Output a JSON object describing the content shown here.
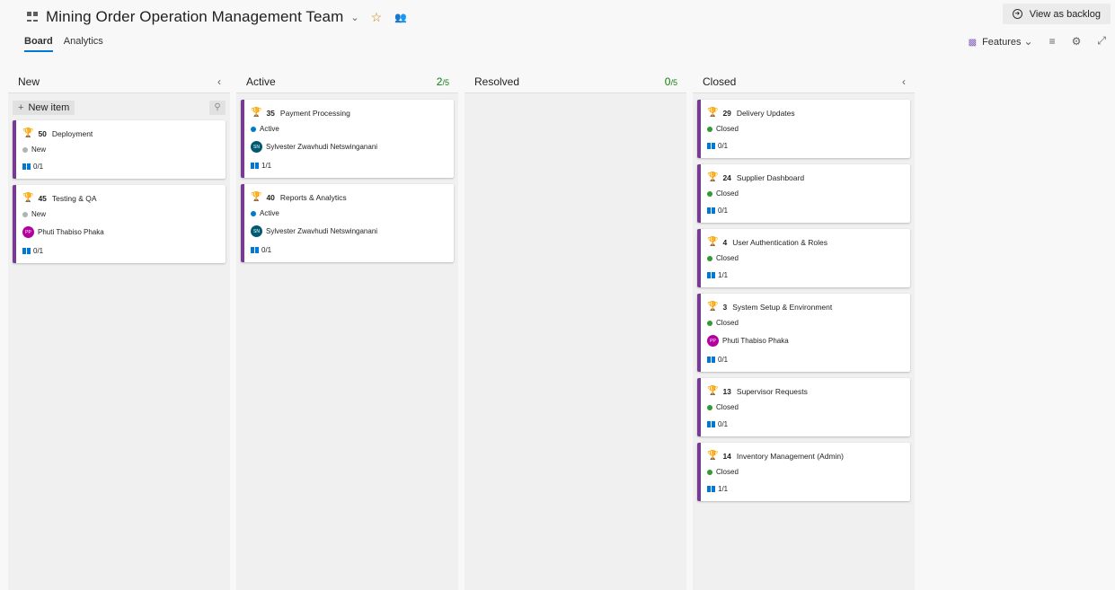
{
  "header": {
    "team_title": "Mining Order Operation Management Team",
    "view_backlog_label": "View as backlog",
    "tabs": [
      {
        "label": "Board",
        "active": true
      },
      {
        "label": "Analytics",
        "active": false
      }
    ],
    "features_label": "Features"
  },
  "colors": {
    "accent": "#0078d4",
    "feature": "#773b93",
    "new": "#b2b2b2",
    "active": "#007acc",
    "closed": "#339933"
  },
  "columns": [
    {
      "title": "New",
      "wip": "",
      "new_item_label": "New item",
      "cards": [
        {
          "id": "50",
          "title": "Deployment",
          "state": "New",
          "assignee": null,
          "initials": null,
          "progress": "0/1"
        },
        {
          "id": "45",
          "title": "Testing & QA",
          "state": "New",
          "assignee": "Phuti Thabiso Phaka",
          "initials": "PP",
          "progress": "0/1"
        }
      ]
    },
    {
      "title": "Active",
      "wip": "2",
      "wip_limit": "/5",
      "cards": [
        {
          "id": "35",
          "title": "Payment Processing",
          "state": "Active",
          "assignee": "Sylvester Zwavhudi Netswinganani",
          "initials": "SN",
          "progress": "1/1"
        },
        {
          "id": "40",
          "title": "Reports & Analytics",
          "state": "Active",
          "assignee": "Sylvester Zwavhudi Netswinganani",
          "initials": "SN",
          "progress": "0/1"
        }
      ]
    },
    {
      "title": "Resolved",
      "wip": "0",
      "wip_limit": "/5",
      "cards": []
    },
    {
      "title": "Closed",
      "wip": "",
      "cards": [
        {
          "id": "29",
          "title": "Delivery Updates",
          "state": "Closed",
          "assignee": null,
          "initials": null,
          "progress": "0/1"
        },
        {
          "id": "24",
          "title": "Supplier Dashboard",
          "state": "Closed",
          "assignee": null,
          "initials": null,
          "progress": "0/1"
        },
        {
          "id": "4",
          "title": "User Authentication & Roles",
          "state": "Closed",
          "assignee": null,
          "initials": null,
          "progress": "1/1"
        },
        {
          "id": "3",
          "title": "System Setup & Environment",
          "state": "Closed",
          "assignee": "Phuti Thabiso Phaka",
          "initials": "PP",
          "progress": "0/1"
        },
        {
          "id": "13",
          "title": "Supervisor Requests",
          "state": "Closed",
          "assignee": null,
          "initials": null,
          "progress": "0/1"
        },
        {
          "id": "14",
          "title": "Inventory Management (Admin)",
          "state": "Closed",
          "assignee": null,
          "initials": null,
          "progress": "1/1"
        }
      ]
    }
  ]
}
